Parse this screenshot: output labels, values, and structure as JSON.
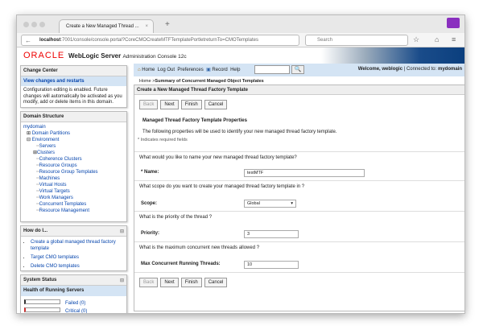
{
  "browser": {
    "tab_title": "Create a New Managed Thread ...",
    "url_host": "localhost",
    "url_rest": ":7001/console/console.portal?CoreCMOCreateMTFTemplatePortletreturnTo=CMOTemplates",
    "search_placeholder": "Search"
  },
  "header": {
    "brand": "ORACLE",
    "product": "WebLogic Server",
    "subtitle": "Administration Console 12c"
  },
  "toolbar": {
    "home": "Home",
    "logout": "Log Out",
    "preferences": "Preferences",
    "record": "Record",
    "help": "Help",
    "welcome": "Welcome, weblogic",
    "connected_label": "Connected to:",
    "domain": "mydomain"
  },
  "breadcrumb": {
    "home": "Home >",
    "current": "Summary of Concurrent Managed Object Templates"
  },
  "change_center": {
    "title": "Change Center",
    "link": "View changes and restarts",
    "text": "Configuration editing is enabled. Future changes will automatically be activated as you modify, add or delete items in this domain."
  },
  "domain_structure": {
    "title": "Domain Structure",
    "root": "mydomain",
    "items": [
      "Domain Partitions",
      "Environment",
      "Servers",
      "Clusters",
      "Coherence Clusters",
      "Resource Groups",
      "Resource Group Templates",
      "Machines",
      "Virtual Hosts",
      "Virtual Targets",
      "Work Managers",
      "Concurrent Templates",
      "Resource Management"
    ]
  },
  "how_do_i": {
    "title": "How do I...",
    "items": [
      "Create a global managed thread factory template",
      "Target CMO templates",
      "Delete CMO templates"
    ]
  },
  "system_status": {
    "title": "System Status",
    "subtitle": "Health of Running Servers",
    "items": [
      "Failed (0)",
      "Critical (0)"
    ]
  },
  "main": {
    "title": "Create a New Managed Thread Factory Template",
    "buttons": {
      "back": "Back",
      "next": "Next",
      "finish": "Finish",
      "cancel": "Cancel"
    },
    "section": "Managed Thread Factory Template Properties",
    "desc": "The following properties will be used to identify your new managed thread factory template.",
    "required_note": "* Indicates required fields",
    "q_name": "What would you like to name your new managed thread factory template?",
    "name_label": "* Name:",
    "name_value": "testMTF",
    "q_scope": "What scope do you want to create your managed thread factory template in ?",
    "scope_label": "Scope:",
    "scope_value": "Global",
    "q_priority": "What is the priority of the thread ?",
    "priority_label": "Priority:",
    "priority_value": "3",
    "q_max": "What is the maximum concurrent new threads allowed ?",
    "max_label": "Max Concurrent Running Threads:",
    "max_value": "10"
  }
}
